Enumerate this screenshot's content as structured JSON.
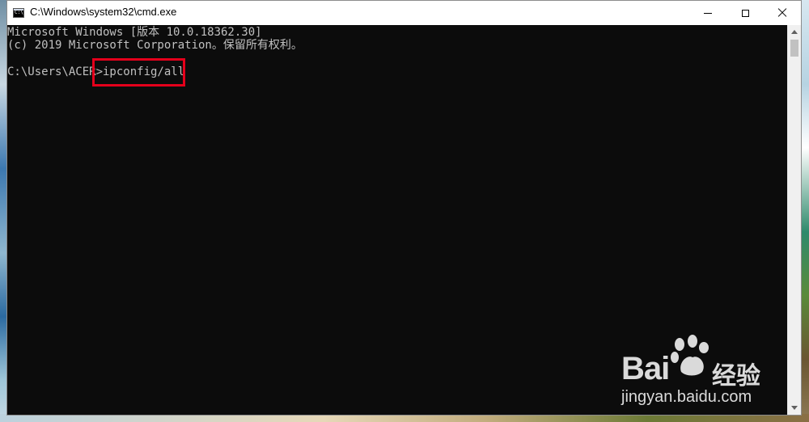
{
  "window": {
    "title": "C:\\Windows\\system32\\cmd.exe",
    "icon_label": "C:\\"
  },
  "console": {
    "lines": [
      "Microsoft Windows [版本 10.0.18362.30]",
      "(c) 2019 Microsoft Corporation。保留所有权利。",
      "C:\\Users\\ACER>ipconfig/all"
    ],
    "text_color": "#c0c0c0",
    "background": "#0c0c0c",
    "highlight_color": "#e4001b"
  },
  "watermark": {
    "logo_text": "Bai",
    "logo_suffix_text": "经验",
    "url": "jingyan.baidu.com"
  },
  "icons": {
    "minimize": "minimize-icon",
    "maximize": "maximize-icon",
    "close": "close-icon",
    "app": "cmd-app-icon"
  }
}
